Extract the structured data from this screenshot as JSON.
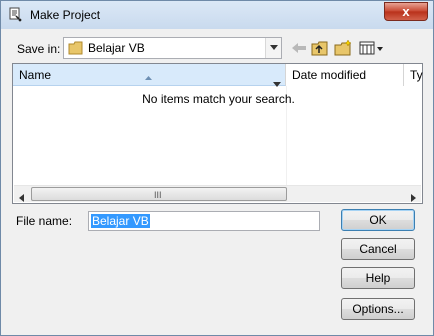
{
  "window": {
    "title": "Make Project",
    "close_label": "x"
  },
  "toolbar": {
    "save_in_label": "Save in:",
    "save_in_value": "Belajar VB",
    "icons": [
      "back-arrow-icon",
      "up-folder-icon",
      "new-folder-icon",
      "view-menu-icon"
    ]
  },
  "listview": {
    "columns": [
      "Name",
      "Date modified",
      "Ty"
    ],
    "empty_message": "No items match your search.",
    "scroll_grip": "III"
  },
  "filename": {
    "label": "File name:",
    "value": "Belajar VB"
  },
  "buttons": {
    "ok": "OK",
    "cancel": "Cancel",
    "help": "Help",
    "options": "Options..."
  },
  "colors": {
    "title_gradient": "#c9daee",
    "close": "#c7452f",
    "selection": "#3399ff",
    "header_selected": "#d8eafb"
  }
}
